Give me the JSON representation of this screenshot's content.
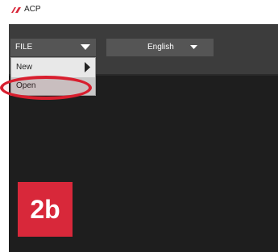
{
  "titlebar": {
    "app_name": "ACP",
    "logo": "acp-logo-icon"
  },
  "toolbar": {
    "file_dropdown": {
      "label": "FILE",
      "icon": "triangle-down-icon"
    },
    "language_dropdown": {
      "selected": "English",
      "icon": "triangle-down-icon"
    }
  },
  "file_menu": {
    "items": [
      {
        "label": "New",
        "icon": "submenu-arrow-icon"
      },
      {
        "label": "Open"
      }
    ]
  },
  "annotation": {
    "badge": "2b",
    "color": "#d8283a"
  }
}
